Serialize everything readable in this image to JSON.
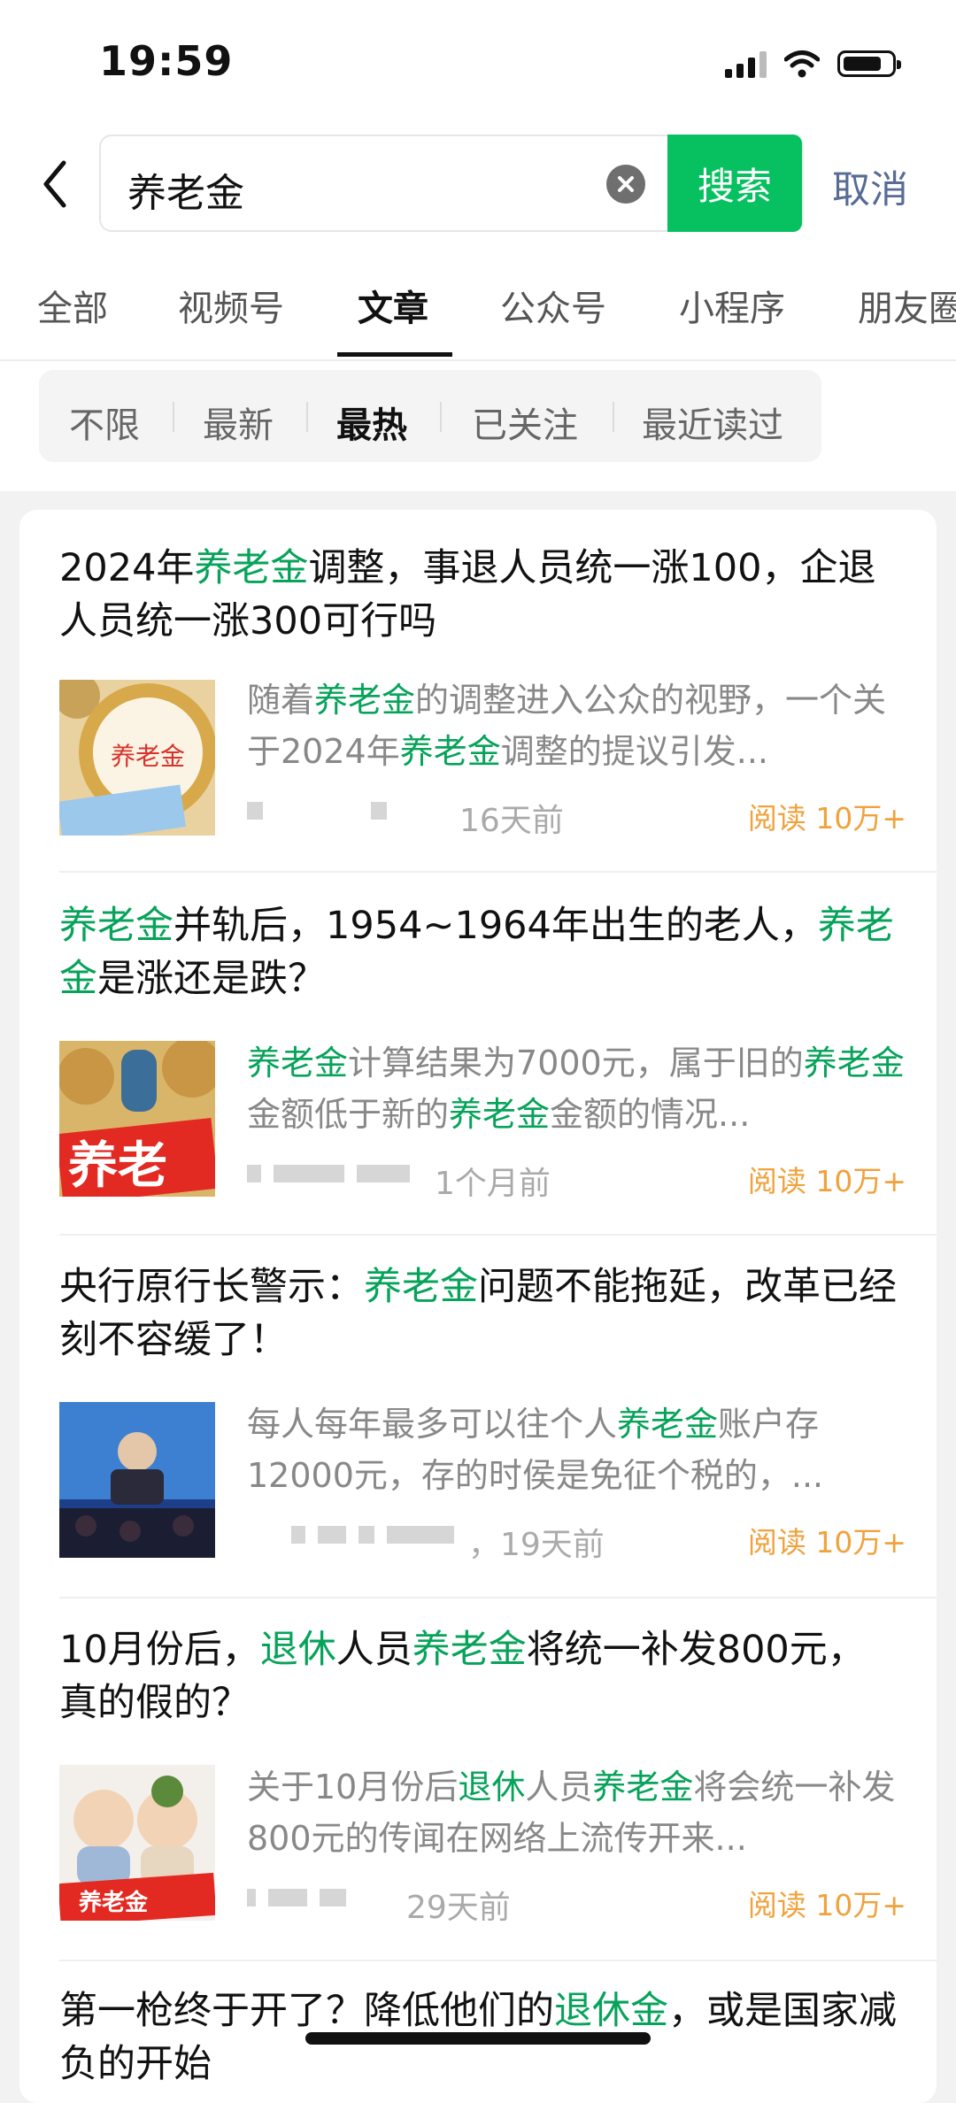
{
  "status_bar": {
    "time": "19:59"
  },
  "search": {
    "query": "养老金",
    "search_label": "搜索",
    "cancel_label": "取消"
  },
  "tabs": [
    "全部",
    "视频号",
    "文章",
    "公众号",
    "小程序",
    "朋友圈"
  ],
  "active_tab": "文章",
  "filters": [
    "不限",
    "最新",
    "最热",
    "已关注",
    "最近读过"
  ],
  "active_filter": "最热",
  "articles": [
    {
      "title": [
        {
          "t": "2024年"
        },
        {
          "t": "养老金",
          "h": true
        },
        {
          "t": "调整，事退人员统一涨100，企退人员统一涨300可行吗"
        }
      ],
      "summary": [
        {
          "t": "随着"
        },
        {
          "t": "养老金",
          "h": true
        },
        {
          "t": "的调整进入公众的视野，一个关于2024年"
        },
        {
          "t": "养老金",
          "h": true
        },
        {
          "t": "调整的提议引发..."
        }
      ],
      "time": "16天前",
      "reads": "阅读 10万+",
      "thumb_text": "养老金"
    },
    {
      "title": [
        {
          "t": "养老金",
          "h": true
        },
        {
          "t": "并轨后，1954~1964年出生的老人，"
        },
        {
          "t": "养老金",
          "h": true
        },
        {
          "t": "是涨还是跌？"
        }
      ],
      "summary": [
        {
          "t": "养老金",
          "h": true
        },
        {
          "t": "计算结果为7000元，属于旧的"
        },
        {
          "t": "养老金",
          "h": true
        },
        {
          "t": "金额低于新的"
        },
        {
          "t": "养老金",
          "h": true
        },
        {
          "t": "金额的情况..."
        }
      ],
      "time": "1个月前",
      "reads": "阅读 10万+",
      "thumb_text": "养老"
    },
    {
      "title": [
        {
          "t": "央行原行长警示："
        },
        {
          "t": "养老金",
          "h": true
        },
        {
          "t": "问题不能拖延，改革已经刻不容缓了！"
        }
      ],
      "summary": [
        {
          "t": "每人每年最多可以往个人"
        },
        {
          "t": "养老金",
          "h": true
        },
        {
          "t": "账户存12000元，存的时侯是免征个税的，..."
        }
      ],
      "time": "，19天前",
      "reads": "阅读 10万+",
      "thumb_text": ""
    },
    {
      "title": [
        {
          "t": "10月份后，"
        },
        {
          "t": "退休",
          "h": true
        },
        {
          "t": "人员"
        },
        {
          "t": "养老金",
          "h": true
        },
        {
          "t": "将统一补发800元，真的假的？"
        }
      ],
      "summary": [
        {
          "t": "关于10月份后"
        },
        {
          "t": "退休",
          "h": true
        },
        {
          "t": "人员"
        },
        {
          "t": "养老金",
          "h": true
        },
        {
          "t": "将会统一补发800元的传闻在网络上流传开来..."
        }
      ],
      "time": "29天前",
      "reads": "阅读 10万+",
      "thumb_text": "养老金"
    },
    {
      "title": [
        {
          "t": "第一枪终于开了？降低他们的"
        },
        {
          "t": "退休金",
          "h": true
        },
        {
          "t": "，或是国家减负的开始"
        }
      ],
      "summary": [],
      "time": "",
      "reads": "",
      "thumb_text": ""
    }
  ],
  "colors": {
    "accent": "#07c160",
    "highlight": "#07a35a",
    "reads": "#f0a23c",
    "cancel": "#576b95"
  }
}
